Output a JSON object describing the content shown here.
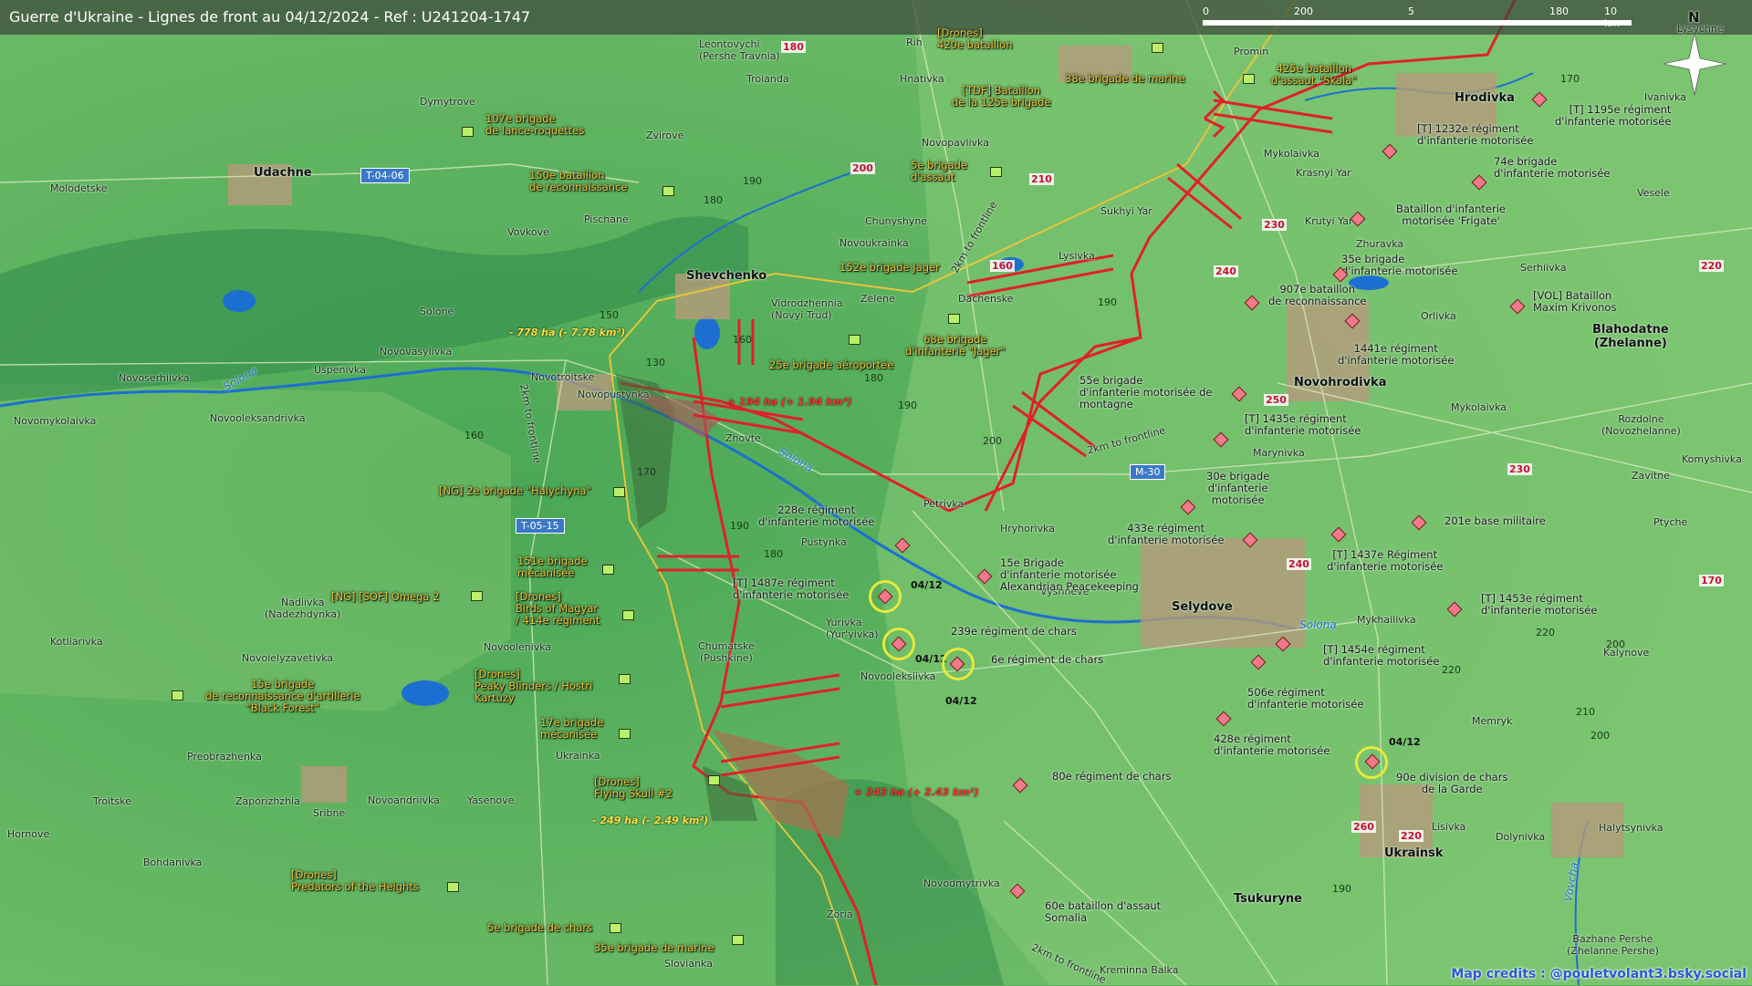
{
  "header": {
    "title": "Guerre d'Ukraine - Lignes de front au 04/12/2024 - Ref : U241204-1747",
    "scale_labels": [
      "0",
      "200",
      "5",
      "180",
      "10 km"
    ],
    "north_label": "N"
  },
  "towns": [
    {
      "name": "Udachne",
      "big": true
    },
    {
      "name": "Shevchenko",
      "big": true
    },
    {
      "name": "Novohrodivka",
      "big": true
    },
    {
      "name": "Selydove",
      "big": true
    },
    {
      "name": "Hrodivka",
      "big": true
    },
    {
      "name": "Ukrainsk",
      "big": true
    },
    {
      "name": "Tsukuryne",
      "big": true
    },
    {
      "name": "Blahodatne\n(Zhelanne)",
      "big": true
    },
    {
      "name": "Leontovychi\n(Pershe Travnia)"
    },
    {
      "name": "Troianda"
    },
    {
      "name": "Rih"
    },
    {
      "name": "Hnativka"
    },
    {
      "name": "Promin"
    },
    {
      "name": "Lysychne"
    },
    {
      "name": "Dymytrove"
    },
    {
      "name": "Zvirove"
    },
    {
      "name": "Novopavlivka"
    },
    {
      "name": "Mykolaivka"
    },
    {
      "name": "Ivanivka"
    },
    {
      "name": "Molodetske"
    },
    {
      "name": "Pischane"
    },
    {
      "name": "Chunyshyne"
    },
    {
      "name": "Sukhyi Yar"
    },
    {
      "name": "Krasnyi Yar"
    },
    {
      "name": "Vesele"
    },
    {
      "name": "Vovkove"
    },
    {
      "name": "Novoukrainka"
    },
    {
      "name": "Krutyi Yar"
    },
    {
      "name": "Zhuravka"
    },
    {
      "name": "Lysivka"
    },
    {
      "name": "Serhiivka"
    },
    {
      "name": "Vidrodzhennia\n(Novyi Trud)"
    },
    {
      "name": "Zelene"
    },
    {
      "name": "Dachenske"
    },
    {
      "name": "Orlivka"
    },
    {
      "name": "Solone"
    },
    {
      "name": "Novoserhiivka"
    },
    {
      "name": "Uspenivka"
    },
    {
      "name": "Novovasylivka"
    },
    {
      "name": "Novotroitske"
    },
    {
      "name": "Novopustynka"
    },
    {
      "name": "Novomykolaivka"
    },
    {
      "name": "Novooleksandrivka"
    },
    {
      "name": "Zhovte"
    },
    {
      "name": "Mykolaivka"
    },
    {
      "name": "Marynivka"
    },
    {
      "name": "Komyshivka"
    },
    {
      "name": "Zavitne"
    },
    {
      "name": "Rozdolne\n(Novozhelanne)"
    },
    {
      "name": "Petrivka"
    },
    {
      "name": "Hryhorivka"
    },
    {
      "name": "Pustynka"
    },
    {
      "name": "Vyshneve"
    },
    {
      "name": "Ptychе"
    },
    {
      "name": "Yurivka\n(Yur'yivka)"
    },
    {
      "name": "Mykhailivka"
    },
    {
      "name": "Kalynove"
    },
    {
      "name": "Nadiivka\n(Nadezhdynka)"
    },
    {
      "name": "Novoielyzavetivka"
    },
    {
      "name": "Kotliarivka"
    },
    {
      "name": "Novoolenivka"
    },
    {
      "name": "Chumatske\n(Pushkine)"
    },
    {
      "name": "Novooleksiivka"
    },
    {
      "name": "Memryk"
    },
    {
      "name": "Preobrazhenka"
    },
    {
      "name": "Ukrainka"
    },
    {
      "name": "Troitske"
    },
    {
      "name": "Zaporizhzhia"
    },
    {
      "name": "Novoandriivka"
    },
    {
      "name": "Yasenove"
    },
    {
      "name": "Sribne"
    },
    {
      "name": "Hornove"
    },
    {
      "name": "Bohdanivka"
    },
    {
      "name": "Lisivka"
    },
    {
      "name": "Dolynivka"
    },
    {
      "name": "Halytsynivka"
    },
    {
      "name": "Novodmytrivka"
    },
    {
      "name": "Zoria"
    },
    {
      "name": "Slovianka"
    },
    {
      "name": "Kreminna Balka"
    },
    {
      "name": "Bazhane Pershe\n(Zhelanne Pershe)"
    }
  ],
  "ua_units": [
    "107e brigade\nde lance-roquettes",
    "150e bataillon\nde reconnaissance",
    "[Drones]\n420e bataillon",
    "[TDF] Bataillon\nde la 125e brigade",
    "38e brigade de marine",
    "425e bataillon\nd'assaut \"Skala\"",
    "5e brigade\nd'assaut",
    "152e brigade Jager",
    "68e brigade\nd'infanterie \"Jager\"",
    "25e brigade aéroportée",
    "[NG] 2e brigade \"Halychyna\"",
    "151e brigade\nmécanisée",
    "[NG] [SOF] Omega 2",
    "[Drones]\nBirds of Magyar\n/ 414e régiment",
    "15e brigade\nde reconnaissance d'artillerie\n\"Black Forest\"",
    "[Drones]\nPeaky Blinders / Hostri\nKartuzy",
    "17e brigade\nmécanisée",
    "[Drones]\nFlying Skull #2",
    "[Drones]\nPredators of the Heights",
    "5e brigade de chars",
    "35e brigade de marine"
  ],
  "ru_units": [
    "[T] 1232e régiment\nd'infanterie motorisée",
    "[T] 1195e régiment\nd'infanterie motorisée",
    "74e brigade\nd'infanterie motorisée",
    "Bataillon d'infanterie\nmotorisée 'Frigate'",
    "35e brigade\nd'infanterie motorisée",
    "907e bataillon\nde reconnaissance",
    "[VOL] Bataillon\nMaxim Krivonos",
    "1441e régiment\nd'infanterie motorisée",
    "55e brigade\nd'infanterie motorisée de\nmontagne",
    "[T] 1435e régiment\nd'infanterie motorisée",
    "30e brigade\nd'infanterie\nmotorisée",
    "228e régiment\nd'infanterie motorisée",
    "433e régiment\nd'infanterie motorisée",
    "201e base militaire",
    "[T] 1437e Régiment\nd'infanterie motorisée",
    "15e Brigade\nd'infanterie motorisée\nAlexandrian Peacekeeping",
    "[T] 1487e régiment\nd'infanterie motorisée",
    "[T] 1453e régiment\nd'infanterie motorisée",
    "239e régiment de chars",
    "6e régiment de chars",
    "[T] 1454e régiment\nd'infanterie motorisée",
    "506e régiment\nd'infanterie motorisée",
    "428e régiment\nd'infanterie motorisée",
    "90e division de chars\nde la Garde",
    "80e régiment de chars",
    "60e bataillon d'assaut\nSomalia"
  ],
  "roads": [
    "T-04-06",
    "T-05-15",
    "M-30"
  ],
  "road_numbers": [
    "180",
    "200",
    "210",
    "230",
    "240",
    "250",
    "240",
    "220",
    "230",
    "170",
    "260",
    "220",
    "160"
  ],
  "elevations": [
    "190",
    "180",
    "190",
    "150",
    "130",
    "180",
    "160",
    "170",
    "190",
    "180",
    "190",
    "200",
    "160",
    "220",
    "220",
    "200",
    "170",
    "210",
    "190",
    "200"
  ],
  "annotations": {
    "loss_1": "- 778 ha (- 7.78 km²)",
    "gain_1": "+ 194 ha (+ 1.94 km²)",
    "gain_2": "+ 243 ha (+ 2.43 km²)",
    "loss_2": "- 249 ha (- 2.49 km²)",
    "frontline_1": "2km to frontline",
    "frontline_2": "2km to frontline",
    "frontline_3": "2km to frontline",
    "frontline_4": "2km to frontline",
    "river_1": "Solona",
    "river_2": "Solona",
    "river_3": "Solona",
    "river_4": "Vovcha",
    "date_1": "04/12",
    "date_2": "04/12",
    "date_3": "04/12",
    "date_4": "04/12"
  },
  "credits": "Map credits : @pouletvolant3.bsky.social",
  "colors": {
    "terrain_light": "#7cc66e",
    "terrain_dark": "#3f9a55",
    "river": "#1c6fd1",
    "ru_line": "#e0202a",
    "ua_line": "#e6c53a",
    "ua_label": "#e8c53a"
  }
}
